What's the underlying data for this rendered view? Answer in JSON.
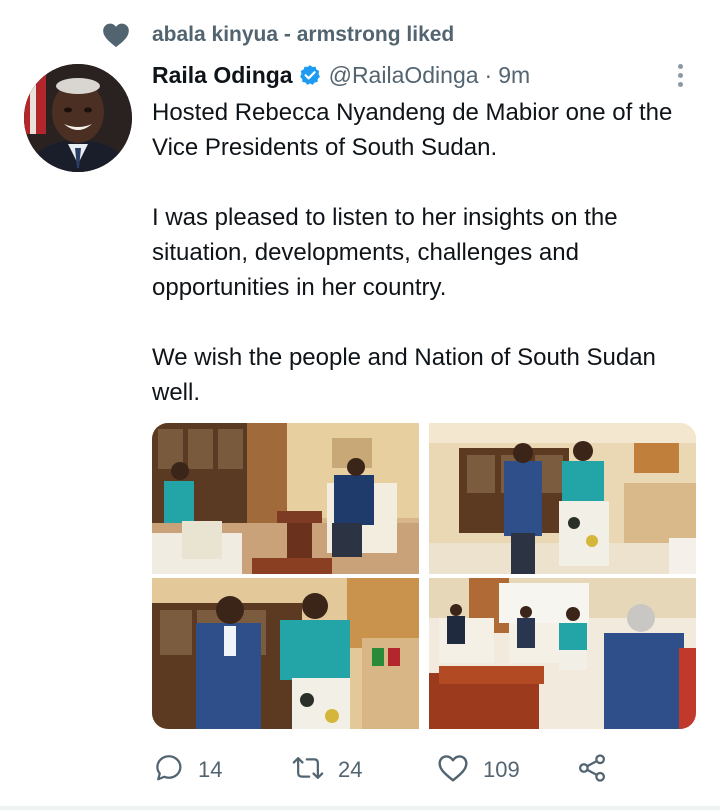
{
  "social_context": {
    "text": "abala kinyua - armstrong liked",
    "icon": "heart-icon"
  },
  "author": {
    "name": "Raila Odinga",
    "handle": "@RailaOdinga",
    "separator": "·",
    "time": "9m",
    "verified": true
  },
  "tweet": {
    "paragraphs": [
      "Hosted Rebecca Nyandeng de Mabior one of the Vice Presidents of South Sudan.",
      "I was pleased to listen to her insights on the situation, developments, challenges and opportunities in her country.",
      "We wish the people and Nation of South Sudan well."
    ]
  },
  "media": {
    "count": 4
  },
  "actions": {
    "reply": {
      "count": "14",
      "icon": "reply-icon"
    },
    "retweet": {
      "count": "24",
      "icon": "retweet-icon"
    },
    "like": {
      "count": "109",
      "icon": "heart-outline-icon"
    },
    "share": {
      "icon": "share-icon"
    }
  },
  "colors": {
    "text": "#0f1419",
    "secondary": "#536471",
    "verified": "#1d9bf0"
  }
}
